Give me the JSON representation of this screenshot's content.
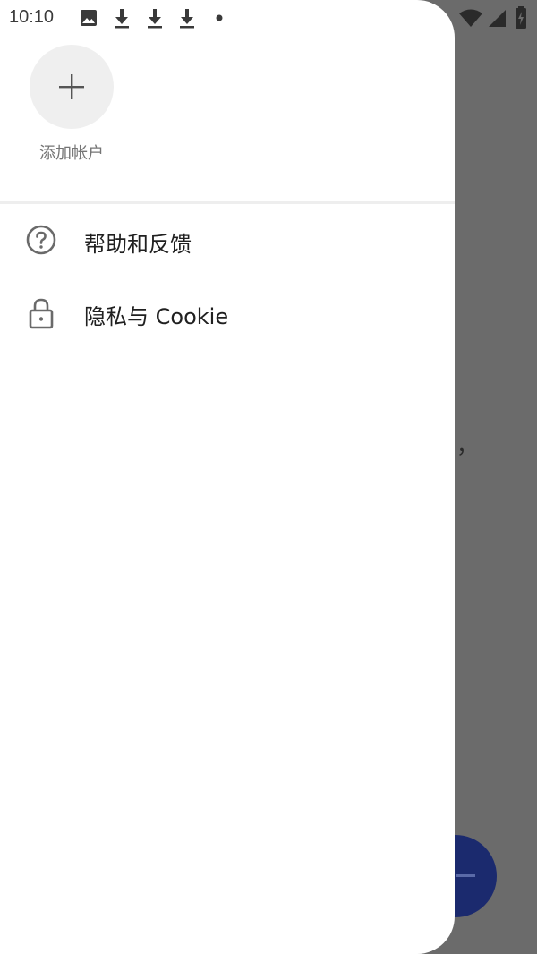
{
  "status_bar": {
    "time": "10:10",
    "left_icons": [
      "image-icon",
      "download-icon",
      "download-icon",
      "download-icon",
      "dot-icon"
    ],
    "right_icons": [
      "wifi-icon",
      "cellular-icon",
      "battery-charging-icon"
    ]
  },
  "drawer": {
    "add_account_label": "添加帐户",
    "menu": [
      {
        "label": "帮助和反馈",
        "icon": "help-icon"
      },
      {
        "label": "隐私与 Cookie",
        "icon": "lock-icon"
      }
    ]
  },
  "background": {
    "text_fragment": "，",
    "fab_color": "#1b2a6e"
  }
}
